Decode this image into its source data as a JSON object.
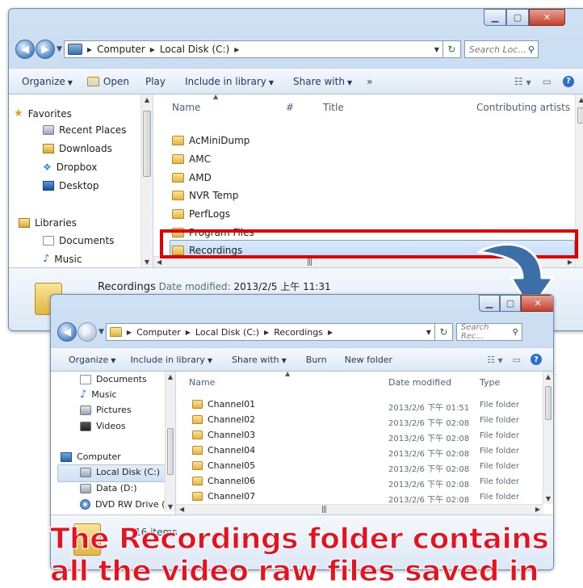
{
  "window1": {
    "breadcrumbs": [
      "Computer",
      "Local Disk (C:)"
    ],
    "search_placeholder": "Search Loc...",
    "toolbar": [
      "Organize",
      "Open",
      "Play",
      "Include in library",
      "Share with",
      "»"
    ],
    "nav": [
      {
        "label": "Favorites",
        "icon": "star-icon"
      },
      {
        "label": "Recent Places",
        "icon": "recent-places-icon"
      },
      {
        "label": "Downloads",
        "icon": "downloads-icon"
      },
      {
        "label": "Dropbox",
        "icon": "dropbox-icon"
      },
      {
        "label": "Desktop",
        "icon": "desktop-icon"
      },
      {
        "label": "Libraries",
        "icon": "libraries-icon"
      },
      {
        "label": "Documents",
        "icon": "documents-icon"
      },
      {
        "label": "Music",
        "icon": "music-icon"
      }
    ],
    "columns": [
      "Name",
      "#",
      "Title",
      "Contributing artists"
    ],
    "folders": [
      "AcMiniDump",
      "AMC",
      "AMD",
      "NVR Temp",
      "PerfLogs",
      "Program Files",
      "Recordings"
    ],
    "selected": "Recordings",
    "details": {
      "name": "Recordings",
      "label": "Date modified:",
      "value": "2013/2/5 上午 11:31"
    }
  },
  "window2": {
    "breadcrumbs": [
      "Computer",
      "Local Disk (C:)",
      "Recordings"
    ],
    "search_placeholder": "Search Rec...",
    "toolbar": [
      "Organize",
      "Include in library",
      "Share with",
      "Burn",
      "New folder"
    ],
    "nav": [
      {
        "label": "Documents",
        "icon": "documents-icon"
      },
      {
        "label": "Music",
        "icon": "music-icon"
      },
      {
        "label": "Pictures",
        "icon": "pictures-icon"
      },
      {
        "label": "Videos",
        "icon": "videos-icon"
      },
      {
        "label": "Computer",
        "icon": "computer-icon"
      },
      {
        "label": "Local Disk (C:)",
        "icon": "local-disk-icon"
      },
      {
        "label": "Data (D:)",
        "icon": "data-drive-icon"
      },
      {
        "label": "DVD RW Drive (E:",
        "icon": "dvd-icon"
      }
    ],
    "selected_nav": "Local Disk (C:)",
    "columns": [
      "Name",
      "Date modified",
      "Type"
    ],
    "rows": [
      {
        "name": "Channel01",
        "date": "2013/2/6 下午 01:51",
        "type": "File folder"
      },
      {
        "name": "Channel02",
        "date": "2013/2/6 下午 02:08",
        "type": "File folder"
      },
      {
        "name": "Channel03",
        "date": "2013/2/6 下午 02:08",
        "type": "File folder"
      },
      {
        "name": "Channel04",
        "date": "2013/2/6 下午 02:08",
        "type": "File folder"
      },
      {
        "name": "Channel05",
        "date": "2013/2/6 下午 02:08",
        "type": "File folder"
      },
      {
        "name": "Channel06",
        "date": "2013/2/6 下午 02:08",
        "type": "File folder"
      },
      {
        "name": "Channel07",
        "date": "2013/2/6 下午 02:08",
        "type": "File folder"
      }
    ],
    "status_count": "16 items"
  },
  "callout": {
    "line1": "The Recordings folder contains",
    "line2": "all the video raw files saved in"
  },
  "colors": {
    "highlight": "#e00000",
    "callout_text": "#e8111f",
    "arrow": "#3c6ea8"
  }
}
